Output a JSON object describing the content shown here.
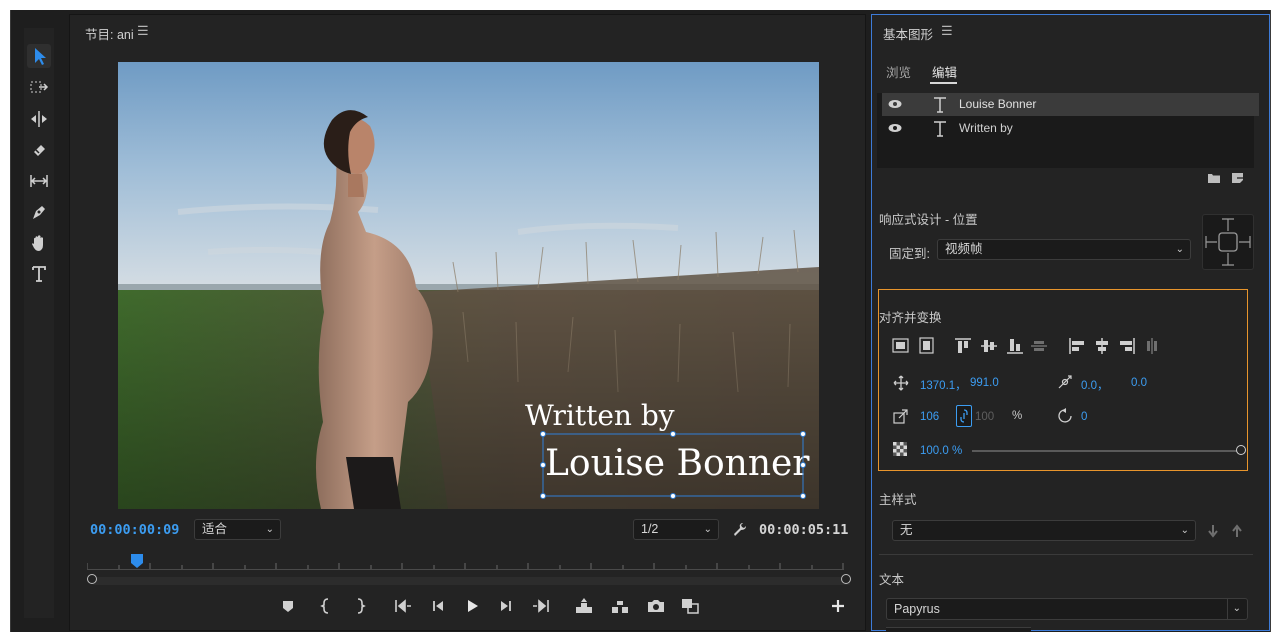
{
  "monitor": {
    "title": "节目: ani",
    "timecode_current": "00:00:00:09",
    "zoom": "适合",
    "resolution": "1/2",
    "timecode_duration": "00:00:05:11",
    "overlay_line1": "Written by",
    "overlay_line2": "Louise Bonner"
  },
  "egp": {
    "title": "基本图形",
    "tabs": [
      "浏览",
      "编辑"
    ],
    "active_tab": "编辑",
    "layers": [
      {
        "name": "Louise Bonner",
        "selected": true
      },
      {
        "name": "Written by",
        "selected": false
      }
    ],
    "responsive": {
      "section_title": "响应式设计 - 位置",
      "pin_label": "固定到:",
      "pin_value": "视频帧"
    },
    "align": {
      "section_title": "对齐并变换",
      "pos_x": "1370.1，",
      "pos_y": "991.0",
      "anchor_x": "0.0，",
      "anchor_y": "0.0",
      "scale": "106",
      "scale_linked": "100",
      "scale_unit": "%",
      "rotation": "0",
      "opacity": "100.0 %",
      "opacity_fraction": 1.0
    },
    "master_style": {
      "section_title": "主样式",
      "value": "无"
    },
    "text": {
      "section_title": "文本",
      "font": "Papyrus"
    }
  },
  "colors": {
    "accent": "#3c9df2",
    "highlight_box": "#e8952c",
    "panel_border": "#3d7bd8"
  }
}
